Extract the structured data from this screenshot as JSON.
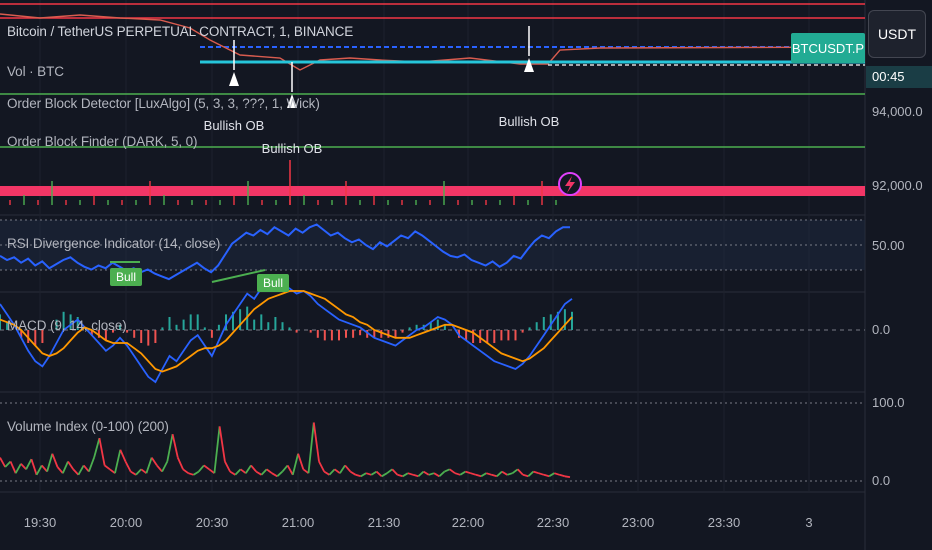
{
  "header": {
    "symbol_title": "Bitcoin / TetherUS PERPETUAL CONTRACT, 1, BINANCE",
    "currency_button": "USDT",
    "pair_badge": "BTCUSDT.P",
    "timer_badge": "00:45"
  },
  "legends": {
    "volume": "Vol · BTC",
    "order_block_detector": "Order Block Detector [LuxAlgo] (5, 3, 3, ???, 1, Wick)",
    "order_block_finder": "Order Block Finder (DARK, 5, 0)",
    "rsi": "RSI Divergence Indicator (14, close)",
    "macd": "MACD (9, 14, close)",
    "volume_index": "Volume Index (0-100) (200)"
  },
  "annotations": {
    "bullish_ob": "Bullish OB",
    "bull": "Bull"
  },
  "colors": {
    "background": "#131722",
    "price_line": "#26c6da",
    "dashed_line": "#2962ff",
    "pink_band": "#f23666",
    "green_line": "#4caf50",
    "red_line": "#f23645",
    "rsi_line": "#2962ff",
    "macd_line": "#2962ff",
    "signal_line": "#ff9800",
    "vol_index_green": "#4caf50",
    "vol_index_red": "#f23645",
    "badge": "#22ab94"
  },
  "chart_data": {
    "type": "line",
    "x_ticks": [
      "19:30",
      "20:00",
      "20:30",
      "21:00",
      "21:30",
      "22:00",
      "22:30",
      "23:00",
      "23:30",
      "3"
    ],
    "price_axis_labels": [
      "94,000.0",
      "92,000.0"
    ],
    "rsi_axis_labels": [
      "50.00"
    ],
    "macd_axis_labels": [
      "0.0"
    ],
    "volume_index_axis_labels": [
      "100.0",
      "0.0"
    ],
    "rsi_values": [
      45,
      42,
      44,
      40,
      43,
      38,
      41,
      36,
      39,
      42,
      44,
      40,
      37,
      35,
      38,
      36,
      40,
      37,
      34,
      36,
      33,
      35,
      32,
      30,
      28,
      31,
      34,
      37,
      40,
      36,
      33,
      38,
      46,
      54,
      58,
      62,
      60,
      64,
      61,
      66,
      63,
      60,
      65,
      62,
      66,
      68,
      64,
      60,
      62,
      58,
      55,
      57,
      53,
      50,
      55,
      52,
      56,
      60,
      58,
      63,
      60,
      56,
      52,
      48,
      45,
      44,
      46,
      42,
      40,
      38,
      41,
      37,
      40,
      45,
      43,
      50,
      56,
      60,
      58,
      63,
      66,
      66
    ],
    "macd_values": [
      10,
      6,
      2,
      -3,
      -8,
      -12,
      -14,
      -10,
      -5,
      0,
      2,
      4,
      1,
      -2,
      -5,
      -8,
      -6,
      -3,
      -6,
      -10,
      -14,
      -18,
      -20,
      -15,
      -10,
      -12,
      -8,
      -4,
      -2,
      -6,
      -10,
      -4,
      2,
      6,
      10,
      14,
      12,
      16,
      15,
      18,
      17,
      16,
      14,
      15,
      13,
      10,
      8,
      6,
      4,
      3,
      2,
      1,
      -1,
      -3,
      -4,
      -5,
      -6,
      -4,
      -2,
      0,
      1,
      3,
      5,
      4,
      2,
      -2,
      -4,
      -6,
      -8,
      -10,
      -12,
      -13,
      -14,
      -15,
      -13,
      -10,
      -6,
      -2,
      2,
      6,
      10,
      12
    ],
    "signal_values": [
      4,
      3,
      2,
      0,
      -3,
      -6,
      -9,
      -10,
      -9,
      -7,
      -4,
      -1,
      1,
      0,
      -2,
      -4,
      -5,
      -5,
      -5,
      -7,
      -9,
      -12,
      -15,
      -16,
      -15,
      -14,
      -12,
      -10,
      -8,
      -7,
      -7,
      -6,
      -4,
      -1,
      2,
      5,
      8,
      10,
      12,
      13,
      14,
      15,
      15,
      15,
      14,
      13,
      12,
      10,
      8,
      6,
      5,
      3,
      2,
      0,
      -1,
      -2,
      -3,
      -3,
      -3,
      -2,
      -1,
      0,
      1,
      2,
      2,
      1,
      0,
      -1,
      -3,
      -5,
      -7,
      -9,
      -10,
      -11,
      -12,
      -11,
      -9,
      -7,
      -4,
      -1,
      2,
      5
    ],
    "volume_index_values": [
      30,
      18,
      25,
      10,
      22,
      15,
      28,
      8,
      20,
      12,
      35,
      18,
      10,
      25,
      15,
      8,
      20,
      12,
      30,
      55,
      20,
      15,
      10,
      40,
      25,
      12,
      8,
      15,
      10,
      30,
      20,
      12,
      25,
      60,
      30,
      15,
      10,
      8,
      12,
      20,
      15,
      10,
      70,
      25,
      12,
      8,
      15,
      10,
      20,
      12,
      8,
      15,
      10,
      6,
      12,
      20,
      8,
      35,
      15,
      10,
      75,
      25,
      12,
      8,
      15,
      10,
      20,
      12,
      8,
      6,
      10,
      8,
      12,
      6,
      10,
      15,
      8,
      6,
      10,
      8,
      6,
      12,
      8,
      10,
      6,
      12,
      15,
      10,
      8,
      12,
      10,
      8,
      6,
      10,
      8,
      6,
      12,
      8,
      10,
      15,
      8,
      6,
      12,
      10,
      8,
      6,
      10,
      8,
      6,
      5
    ]
  }
}
